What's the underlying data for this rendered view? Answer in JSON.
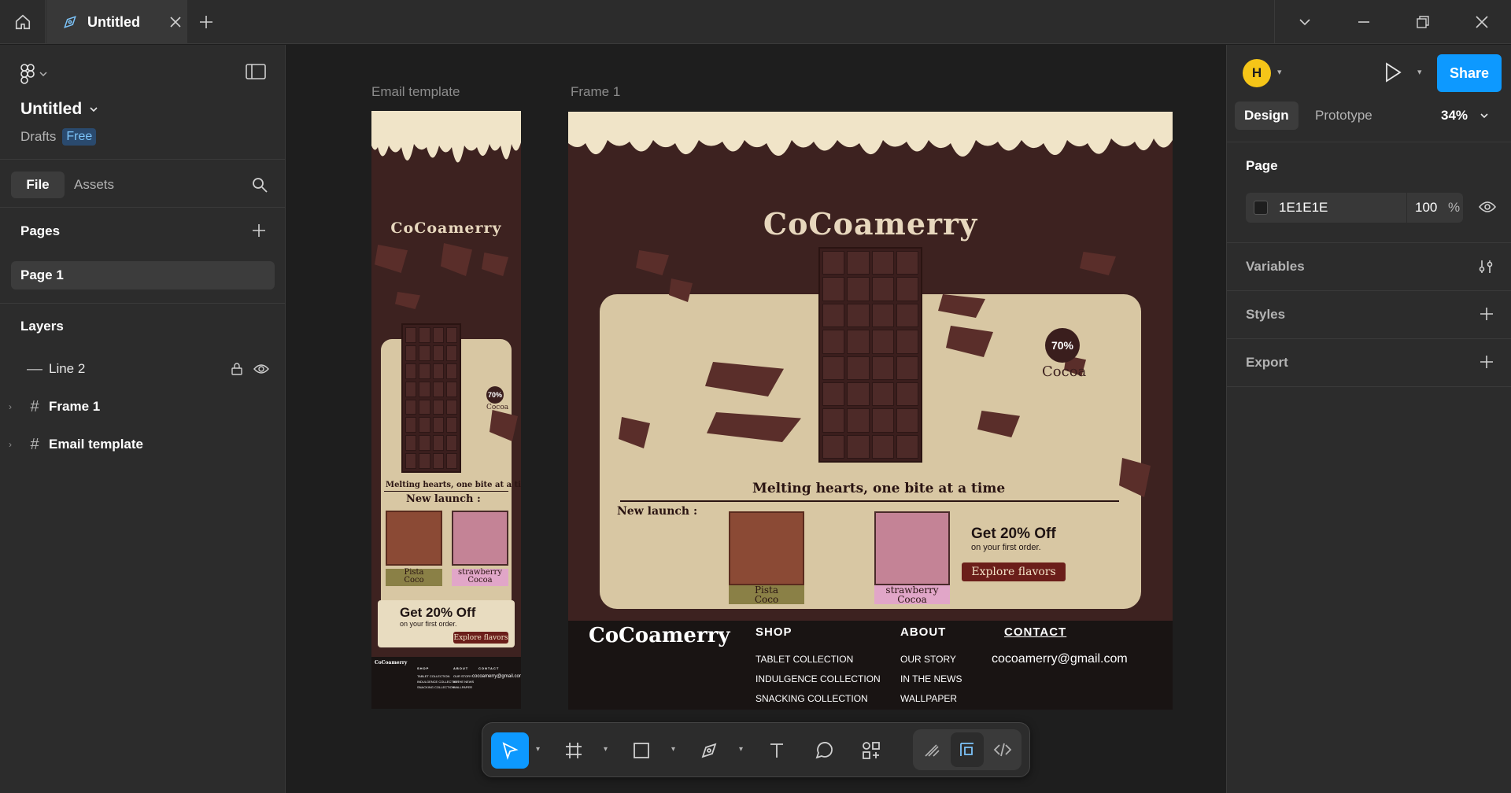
{
  "titlebar": {
    "tab_title": "Untitled"
  },
  "left_panel": {
    "file_title": "Untitled",
    "drafts_label": "Drafts",
    "plan_badge": "Free",
    "tab_file": "File",
    "tab_assets": "Assets",
    "pages_heading": "Pages",
    "pages": [
      {
        "label": "Page 1"
      }
    ],
    "layers_heading": "Layers",
    "layers": [
      {
        "label": "Line 2"
      },
      {
        "label": "Frame 1"
      },
      {
        "label": "Email template"
      }
    ]
  },
  "canvas": {
    "frame_labels": [
      "Email template",
      "Frame 1"
    ],
    "design": {
      "brand": "CoCoamerry",
      "tagline": "Melting hearts, one bite at a time",
      "new_launch": "New launch :",
      "badge_percent": "70%",
      "badge_word": "Cocoa",
      "products": [
        {
          "label_line1": "Pista",
          "label_line2": "Coco"
        },
        {
          "label_line1": "strawberry",
          "label_line2": "Cocoa"
        }
      ],
      "offer_title": "Get 20% Off",
      "offer_sub": "on your first order.",
      "cta": "Explore flavors",
      "footer": {
        "brand": "CoCoamerry",
        "shop_heading": "SHOP",
        "shop_items": [
          "TABLET COLLECTION",
          "INDULGENCE COLLECTION",
          "SNACKING COLLECTION"
        ],
        "about_heading": "ABOUT",
        "about_items": [
          "OUR STORY",
          "IN THE NEWS",
          "WALLPAPER"
        ],
        "contact_heading": "CONTACT",
        "contact_email": "cocoamerry@gmail.com"
      },
      "colors": {
        "chocolate": "#3d2220",
        "cream": "#d8c7a3",
        "footer": "#191413",
        "cta": "#6b1e1a"
      }
    }
  },
  "toolbar": {
    "tools": [
      "move-tool",
      "frame-tool",
      "rectangle-tool",
      "pen-tool",
      "text-tool",
      "comment-tool",
      "actions-tool",
      "draw-mode",
      "design-mode",
      "dev-mode"
    ],
    "help_label": "?"
  },
  "right_panel": {
    "avatar_initial": "H",
    "share_label": "Share",
    "tab_design": "Design",
    "tab_prototype": "Prototype",
    "zoom": "34%",
    "page_heading": "Page",
    "page_color": "1E1E1E",
    "page_opacity": "100",
    "opacity_unit": "%",
    "variables_heading": "Variables",
    "styles_heading": "Styles",
    "export_heading": "Export",
    "accent_color": "#0d99ff"
  }
}
